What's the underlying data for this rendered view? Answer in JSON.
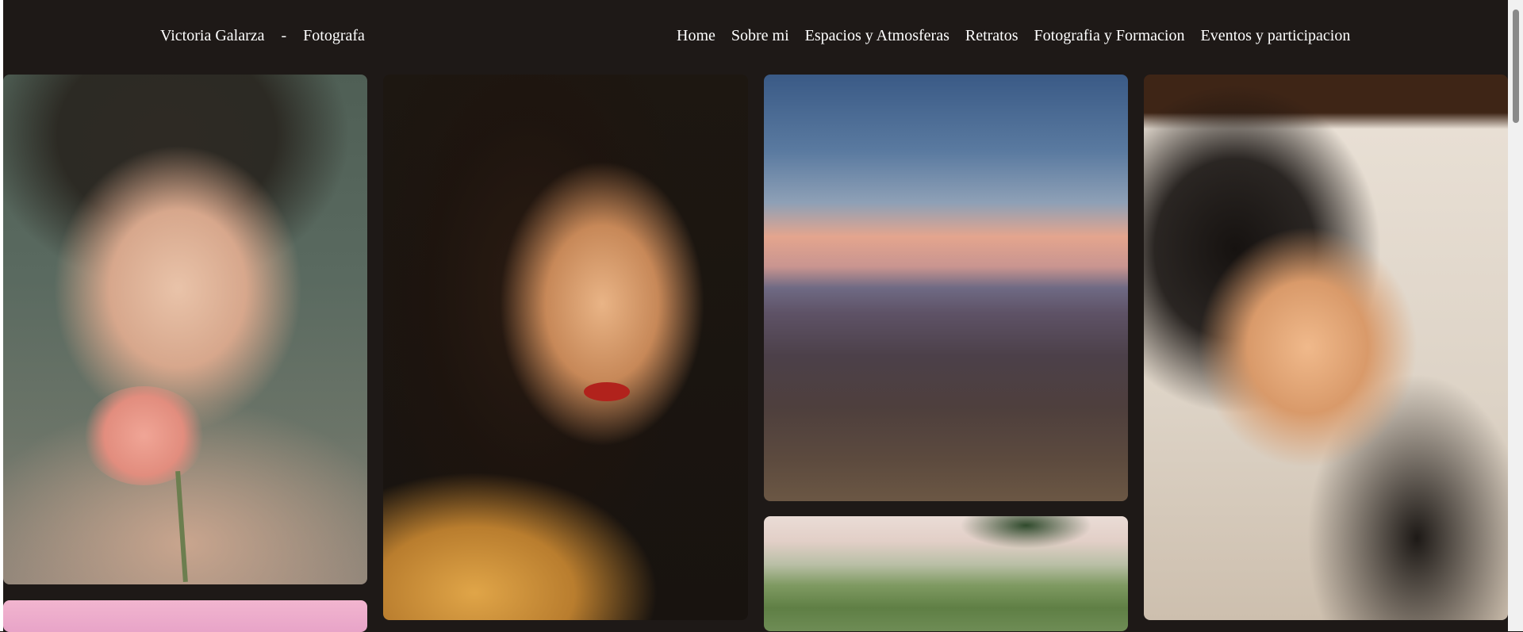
{
  "brand": {
    "name": "Victoria Galarza",
    "separator": "-",
    "role": "Fotografa"
  },
  "nav": {
    "items": [
      {
        "label": "Home"
      },
      {
        "label": "Sobre mi"
      },
      {
        "label": "Espacios y Atmosferas"
      },
      {
        "label": "Retratos"
      },
      {
        "label": "Fotografia y Formacion"
      },
      {
        "label": "Eventos y participacion"
      }
    ]
  },
  "colors": {
    "background": "#1e1917",
    "text": "#ffffff"
  }
}
